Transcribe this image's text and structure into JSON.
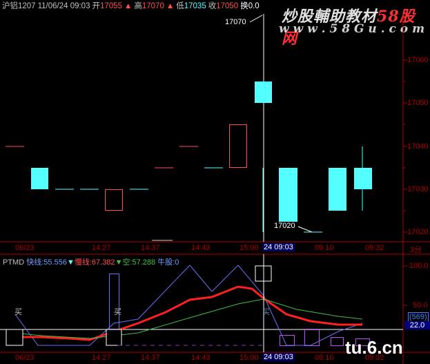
{
  "header": {
    "symbol": "沪铝1207",
    "datetime": "11/06/24 09:03",
    "open_label": "开",
    "open": "17055",
    "high_label": "高",
    "high": "17070",
    "low_label": "低",
    "low": "17035",
    "close_label": "收",
    "close": "17050",
    "turnover_label": "换0.0"
  },
  "watermark": {
    "title": "炒股輔助教材",
    "title_accent": "58股网",
    "url": "w w w . 5 8 G u . c o m"
  },
  "price_axis": {
    "ticks": [
      "17060",
      "17050",
      "17040",
      "17030",
      "17020"
    ]
  },
  "annotations": {
    "high_marker": "17070",
    "low_marker": "17020"
  },
  "time_axis_top": {
    "labels": [
      "06/23",
      "14:27",
      "14:37",
      "14:43",
      "15:00",
      "09:10",
      "09:32"
    ],
    "cursor": "24 09:03",
    "unit": "3分"
  },
  "indicator": {
    "name": "PTMD",
    "fast_label": "快线:",
    "fast_value": "55.556",
    "slow_label": "慢线:",
    "slow_value": "67.382",
    "empty_label": "空:",
    "empty_value": "57.288",
    "bull_label": "牛股:",
    "bull_value": "0",
    "axis_ticks": [
      "100.0",
      "50.0"
    ],
    "tag_value": "(569)",
    "tag_current": "22.0",
    "buy_marks": [
      "买",
      "买",
      "买"
    ]
  },
  "time_axis_bottom": {
    "labels": [
      "06/23",
      "14:27",
      "14:37",
      "14:43",
      "15:00",
      "09:10",
      "09:32"
    ],
    "cursor": "24 09:03"
  },
  "footer_watermark": "tu.6.cn",
  "colors": {
    "up": "#ff5050",
    "down": "#54ffff",
    "axis": "#b00000",
    "fast": "#6e6eff",
    "slow": "#ff2020",
    "empty": "#40c040",
    "header_red": "#ff5050"
  }
}
